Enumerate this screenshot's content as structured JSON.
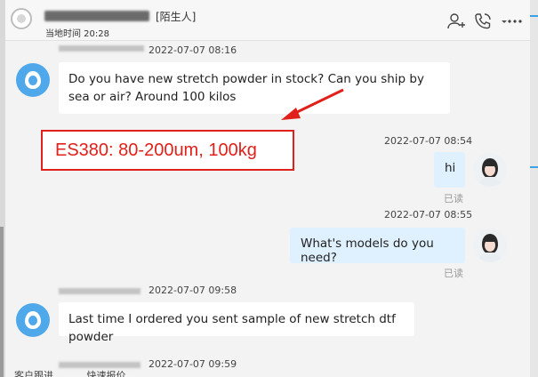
{
  "header": {
    "contact_tag": "[陌生人]",
    "local_time_label": "当地时间 20:28"
  },
  "messages": [
    {
      "side": "left",
      "time": "2022-07-07 08:16",
      "text": "Do you have new stretch powder in stock? Can you ship by sea or air? Around 100 kilos"
    },
    {
      "side": "right",
      "time": "2022-07-07 08:54",
      "text": "hi",
      "status": "已读"
    },
    {
      "side": "right",
      "time": "2022-07-07 08:55",
      "text": "What's models do you need?",
      "status": "已读"
    },
    {
      "side": "left",
      "time": "2022-07-07 09:58",
      "text": "Last time I ordered you sent sample of new stretch dtf powder"
    },
    {
      "side": "left",
      "time": "2022-07-07 09:59",
      "text": ""
    }
  ],
  "annotation": {
    "text": "ES380: 80-200um, 100kg",
    "color": "#e0201a"
  },
  "bottom_tabs": [
    "客户跟进",
    "快速报价"
  ],
  "icons": [
    "add-contact-icon",
    "call-icon",
    "dropdown-icon",
    "more-icon"
  ],
  "colors": {
    "accent": "#4fa8ea",
    "bubble_right": "#dff0ff",
    "annotation": "#e0201a"
  }
}
